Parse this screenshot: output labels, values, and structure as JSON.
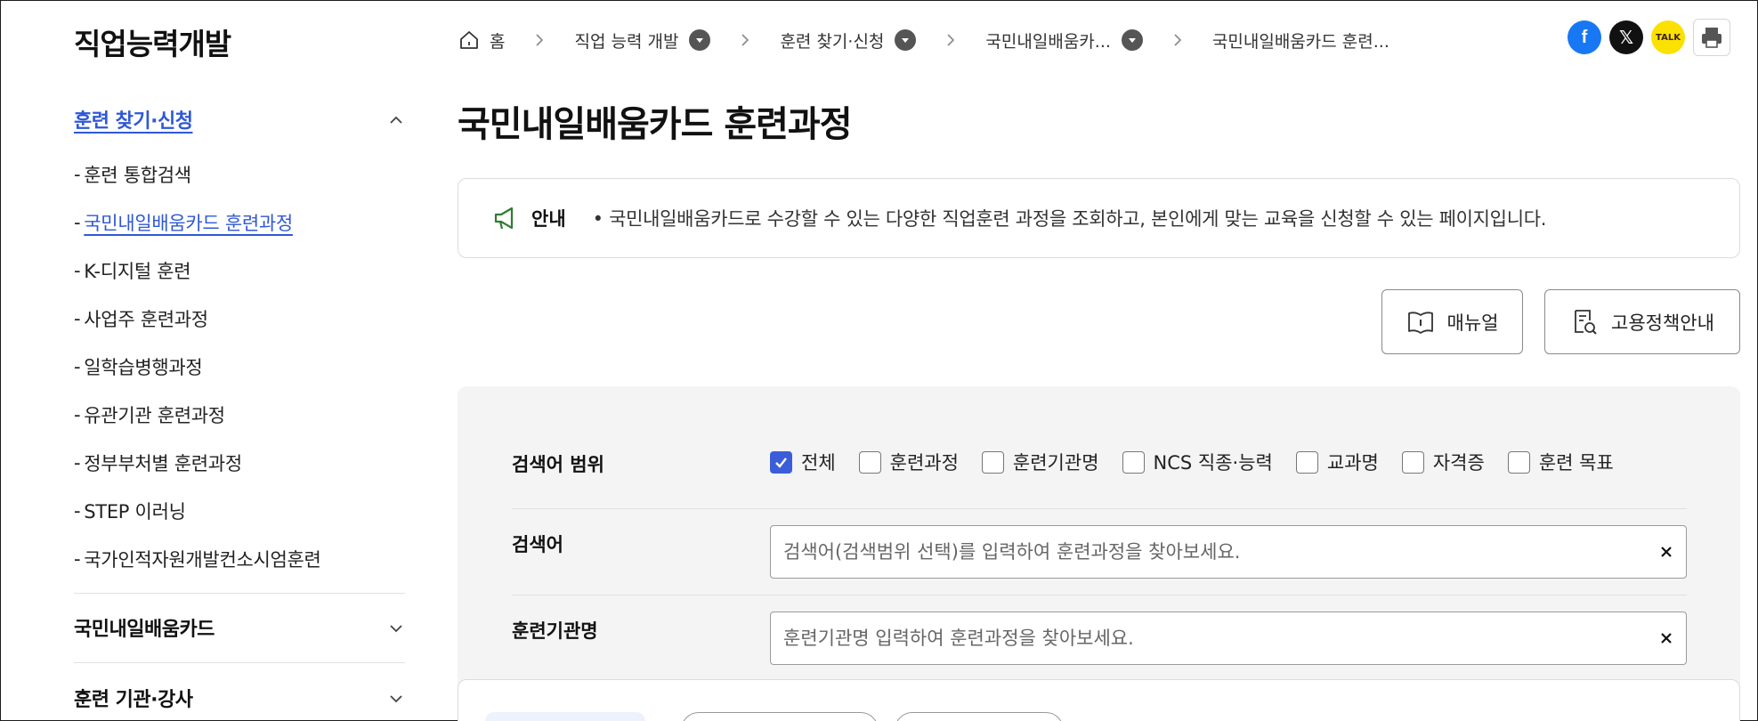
{
  "sidebar": {
    "site_title": "직업능력개발",
    "section_active": "훈련 찾기·신청",
    "items": [
      {
        "label": "훈련 통합검색"
      },
      {
        "label": "국민내일배움카드 훈련과정"
      },
      {
        "label": "K-디지털 훈련"
      },
      {
        "label": "사업주 훈련과정"
      },
      {
        "label": "일학습병행과정"
      },
      {
        "label": "유관기관 훈련과정"
      },
      {
        "label": "정부부처별 훈련과정"
      },
      {
        "label": "STEP 이러닝"
      },
      {
        "label": "국가인적자원개발컨소시엄훈련"
      }
    ],
    "section_2": "국민내일배움카드",
    "section_3": "훈련 기관·강사",
    "dash": "-"
  },
  "breadcrumb": {
    "home": "홈",
    "c1": "직업 능력 개발",
    "c2": "훈련 찾기·신청",
    "c3": "국민내일배움카...",
    "c4": "국민내일배움카드 훈련..."
  },
  "share": {
    "facebook": "f",
    "x": "𝕏",
    "talk": "TALK"
  },
  "page_title": "국민내일배움카드 훈련과정",
  "notice": {
    "label": "안내",
    "text": "• 국민내일배움카드로 수강할 수 있는 다양한 직업훈련 과정을 조회하고, 본인에게 맞는 교육을 신청할 수 있는 페이지입니다."
  },
  "buttons": {
    "manual": "매뉴얼",
    "policy": "고용정책안내"
  },
  "search": {
    "scope_label": "검색어 범위",
    "scope_options": [
      {
        "label": "전체",
        "checked": true
      },
      {
        "label": "훈련과정",
        "checked": false
      },
      {
        "label": "훈련기관명",
        "checked": false
      },
      {
        "label": "NCS 직종·능력",
        "checked": false
      },
      {
        "label": "교과명",
        "checked": false
      },
      {
        "label": "자격증",
        "checked": false
      },
      {
        "label": "훈련 목표",
        "checked": false
      }
    ],
    "keyword_label": "검색어",
    "keyword_placeholder": "검색어(검색범위 선택)를 입력하여 훈련과정을 찾아보세요.",
    "institution_label": "훈련기관명",
    "institution_placeholder": "훈련기관명 입력하여 훈련과정을 찾아보세요."
  },
  "colors": {
    "accent": "#2f58d6",
    "checkbox": "#3b5ed8",
    "facebook": "#1877f2",
    "kakao": "#fae100",
    "panel": "#f4f4f4"
  }
}
